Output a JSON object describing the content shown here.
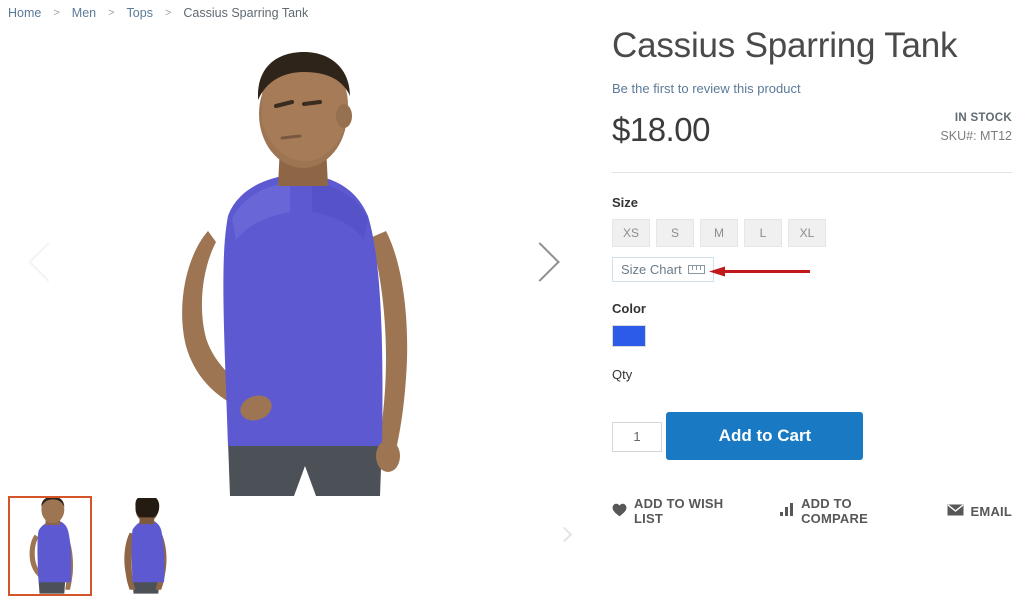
{
  "breadcrumb": {
    "items": [
      {
        "label": "Home",
        "current": false
      },
      {
        "label": "Men",
        "current": false
      },
      {
        "label": "Tops",
        "current": false
      },
      {
        "label": "Cassius Sparring Tank",
        "current": true
      }
    ],
    "separator": ">"
  },
  "gallery": {
    "prev_arrow_name": "chevron-left-icon",
    "next_arrow_name": "chevron-right-icon",
    "thumbs": [
      {
        "alt": "Cassius Sparring Tank front view",
        "selected": true,
        "selected_border_color": "#d4552a"
      },
      {
        "alt": "Cassius Sparring Tank back view",
        "selected": false
      }
    ],
    "garment_color": "#5d5ad1",
    "shorts_color": "#4c5158",
    "skin_color": "#9d7553"
  },
  "product": {
    "title": "Cassius Sparring Tank",
    "review_link": "Be the first to review this product",
    "price": "$18.00",
    "stock_status": "IN STOCK",
    "sku_label": "SKU#:",
    "sku_value": "MT12"
  },
  "options": {
    "size": {
      "label": "Size",
      "values": [
        "XS",
        "S",
        "M",
        "L",
        "XL"
      ],
      "selected": null
    },
    "size_chart": {
      "label": "Size Chart",
      "icon": "ruler-icon",
      "border_color": "#cfe0ec",
      "text_color": "#6b7b88"
    },
    "color": {
      "label": "Color",
      "swatches": [
        {
          "name": "Blue",
          "hex": "#2b5be8",
          "selected": false
        }
      ]
    }
  },
  "annotation": {
    "arrow_color": "#c0181b",
    "points_to": "size-chart-link"
  },
  "qty": {
    "label": "Qty",
    "value": "1",
    "placeholder": "1"
  },
  "cart": {
    "add_label": "Add to Cart",
    "button_color": "#1979c3"
  },
  "actions": [
    {
      "label": "ADD TO WISH LIST",
      "icon": "heart-icon"
    },
    {
      "label": "ADD TO COMPARE",
      "icon": "bar-chart-icon"
    },
    {
      "label": "EMAIL",
      "icon": "envelope-icon"
    }
  ]
}
